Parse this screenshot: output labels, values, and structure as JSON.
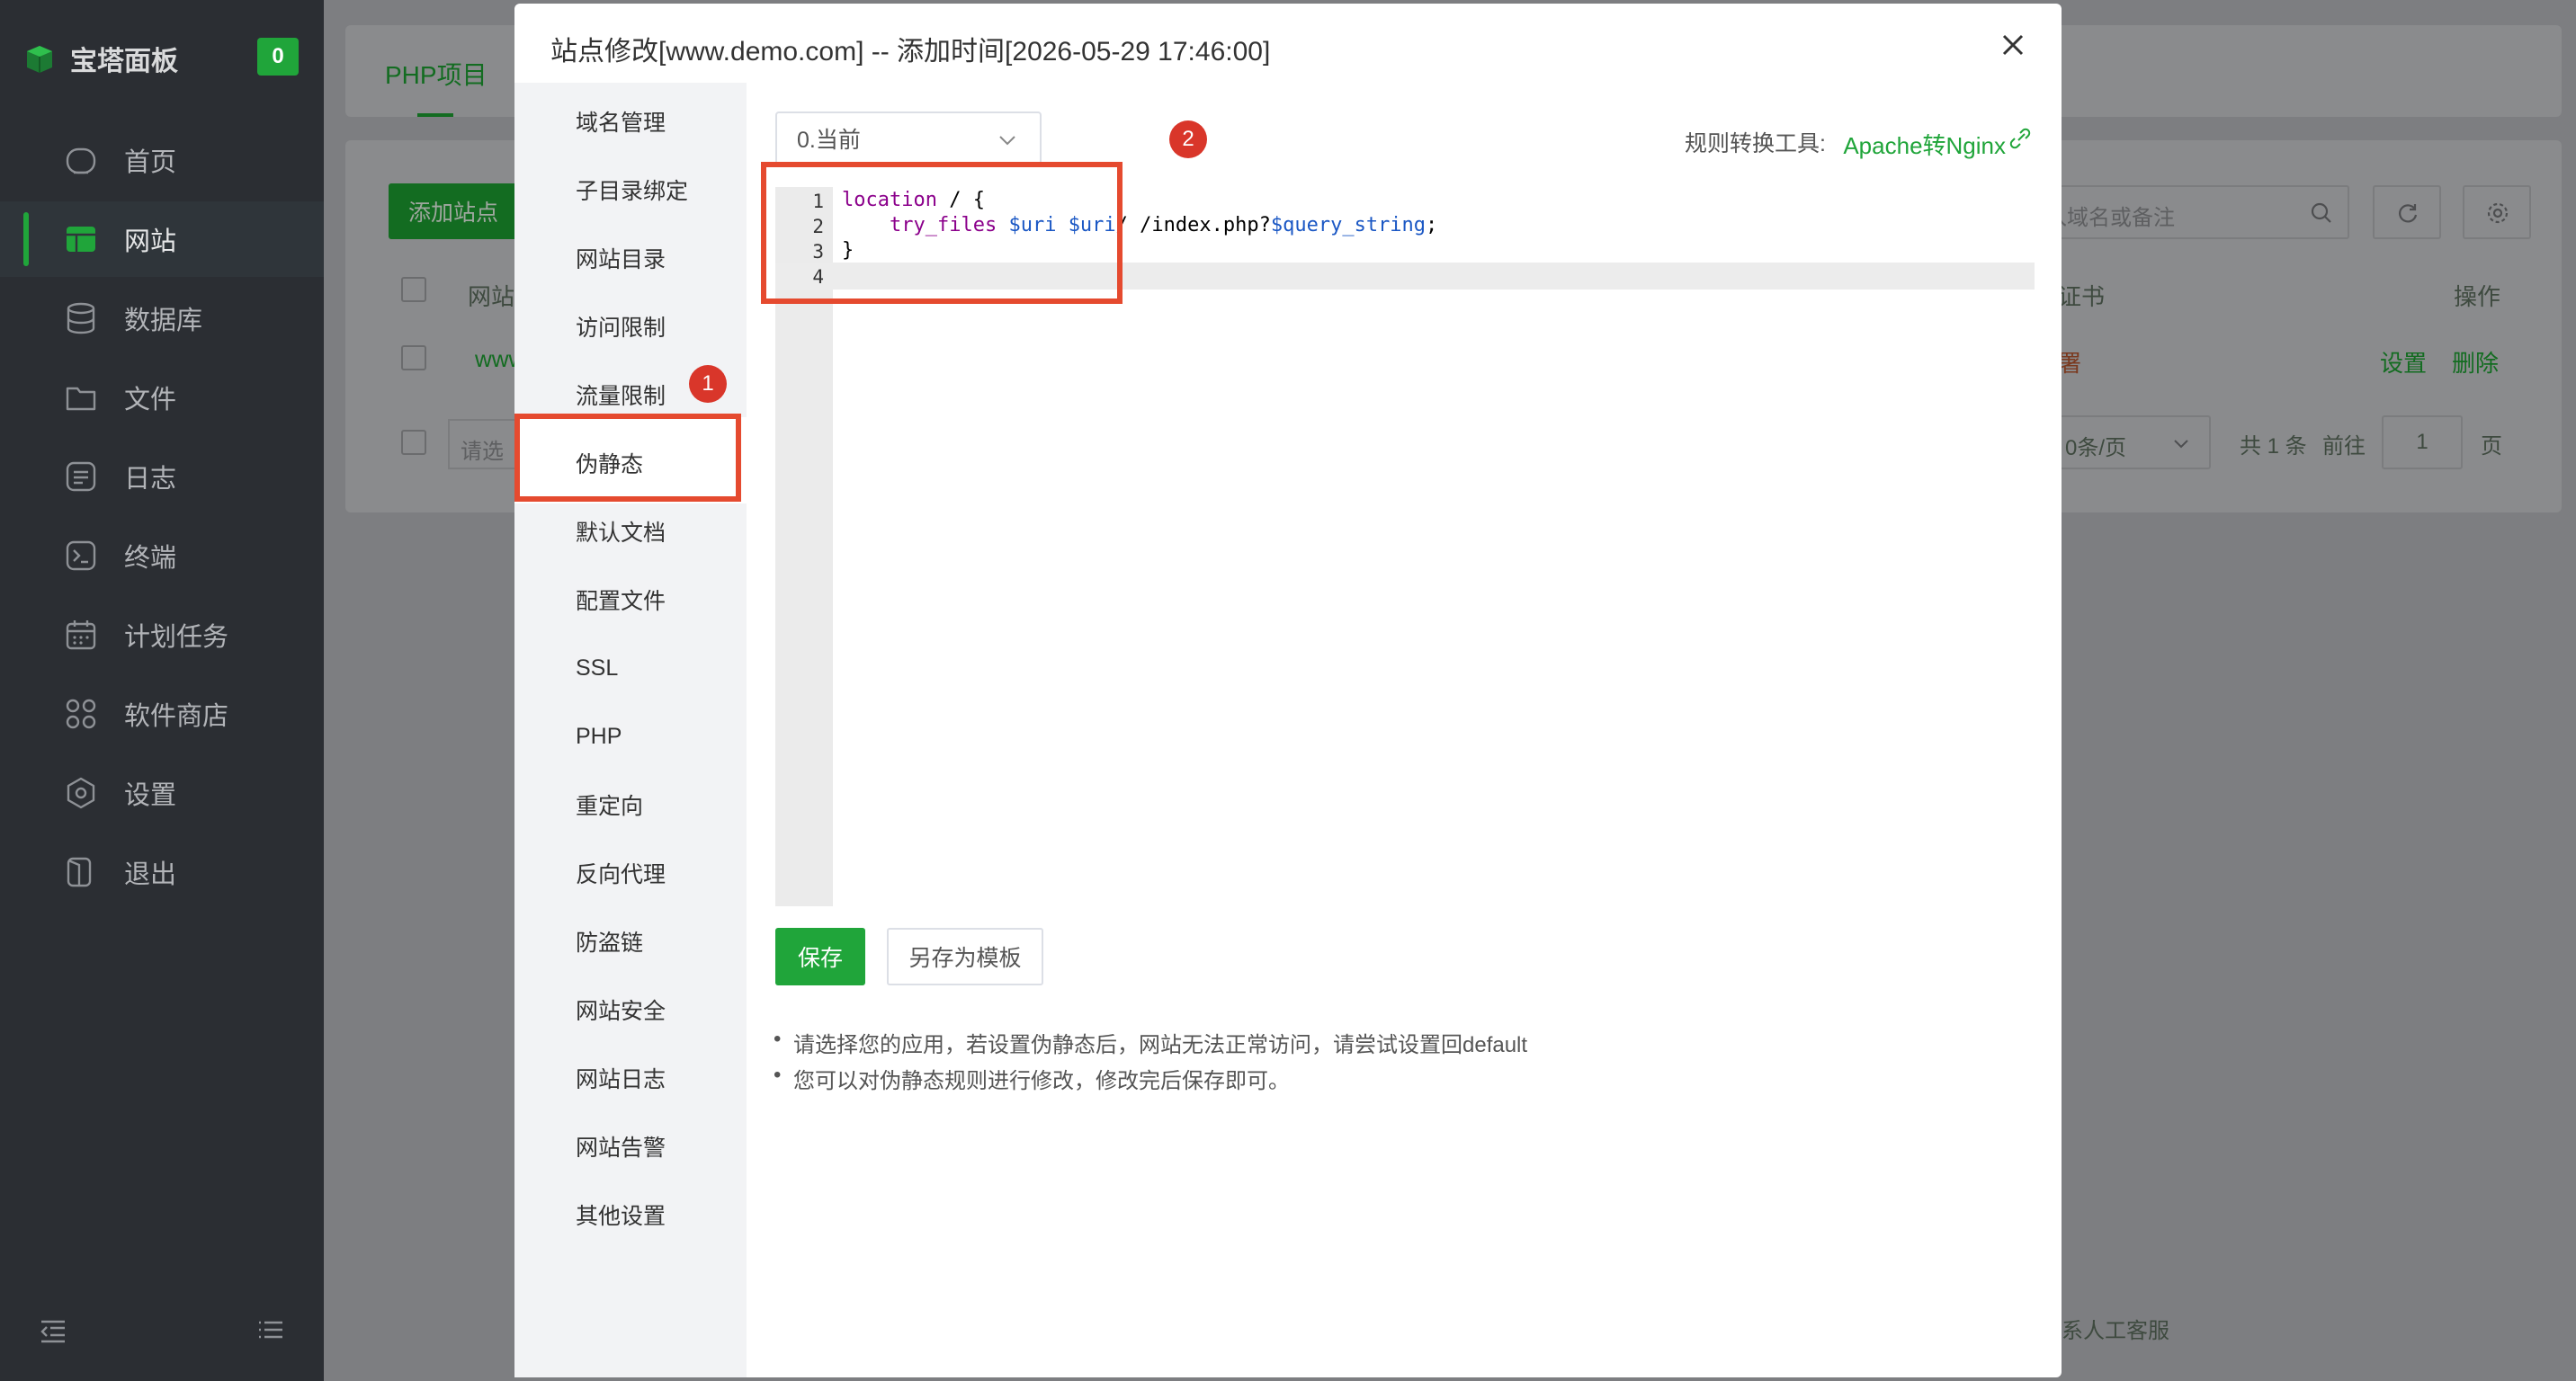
{
  "sidebar": {
    "brand": "宝塔面板",
    "badge": "0",
    "items": [
      {
        "label": "首页",
        "icon": "home-icon"
      },
      {
        "label": "网站",
        "icon": "website-icon",
        "active": true
      },
      {
        "label": "数据库",
        "icon": "database-icon"
      },
      {
        "label": "文件",
        "icon": "folder-icon"
      },
      {
        "label": "日志",
        "icon": "log-icon"
      },
      {
        "label": "终端",
        "icon": "terminal-icon"
      },
      {
        "label": "计划任务",
        "icon": "calendar-icon"
      },
      {
        "label": "软件商店",
        "icon": "apps-icon"
      },
      {
        "label": "设置",
        "icon": "gear-icon"
      },
      {
        "label": "退出",
        "icon": "logout-icon"
      }
    ]
  },
  "background": {
    "tab": "PHP项目",
    "add_site": "添加站点",
    "search_placeholder": "入域名或备注",
    "col_site": "网站",
    "col_cert": "证书",
    "col_ops": "操作",
    "row_site": "www",
    "row_cert": "署",
    "row_set": "设置",
    "row_delete": "删除",
    "batch_placeholder": "请选",
    "page_size": "0条/页",
    "total": "共 1 条",
    "goto": "前往",
    "page_num": "1",
    "page_unit": "页",
    "support": "系人工客服"
  },
  "modal": {
    "title": "站点修改[www.demo.com] -- 添加时间[2026-05-29 17:46:00]",
    "nav": [
      "域名管理",
      "子目录绑定",
      "网站目录",
      "访问限制",
      "流量限制",
      "伪静态",
      "默认文档",
      "配置文件",
      "SSL",
      "PHP",
      "重定向",
      "反向代理",
      "防盗链",
      "网站安全",
      "网站日志",
      "网站告警",
      "其他设置"
    ],
    "active_nav": "伪静态",
    "select_value": "0.当前",
    "tool_label": "规则转换工具:",
    "tool_link": "Apache转Nginx",
    "line_numbers": [
      "1",
      "2",
      "3",
      "4"
    ],
    "code": {
      "l1_kw": "location",
      "l1_rest": " / {",
      "l2_kw": "try_files",
      "l2_v1": "$uri",
      "l2_v2": "$uri",
      "l2_mid": "/ /index.php?",
      "l2_v3": "$query_string",
      "l2_end": ";",
      "l3": "}"
    },
    "save": "保存",
    "save_template": "另存为模板",
    "tips": [
      "请选择您的应用，若设置伪静态后，网站无法正常访问，请尝试设置回default",
      "您可以对伪静态规则进行修改，修改完后保存即可。"
    ],
    "step1": "1",
    "step2": "2"
  }
}
